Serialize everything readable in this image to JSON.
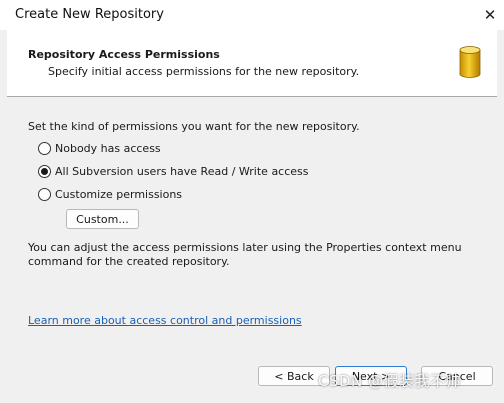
{
  "window": {
    "title": "Create New Repository"
  },
  "header": {
    "title": "Repository Access Permissions",
    "subtitle": "Specify initial access permissions for the new repository.",
    "icon": "database-icon",
    "icon_color": "#e8b30f"
  },
  "main": {
    "prompt": "Set the kind of permissions you want for the new repository.",
    "options": [
      {
        "label": "Nobody has access",
        "checked": false
      },
      {
        "label": "All Subversion users have Read / Write access",
        "checked": true
      },
      {
        "label": "Customize permissions",
        "checked": false
      }
    ],
    "custom_button": "Custom...",
    "note": "You can adjust the access permissions later using the Properties context menu command for the created repository.",
    "link": "Learn more about access control and permissions"
  },
  "footer": {
    "back": "< Back",
    "next": "Next >",
    "cancel": "Cancel"
  },
  "watermark": "CSDN @假装我不帅"
}
